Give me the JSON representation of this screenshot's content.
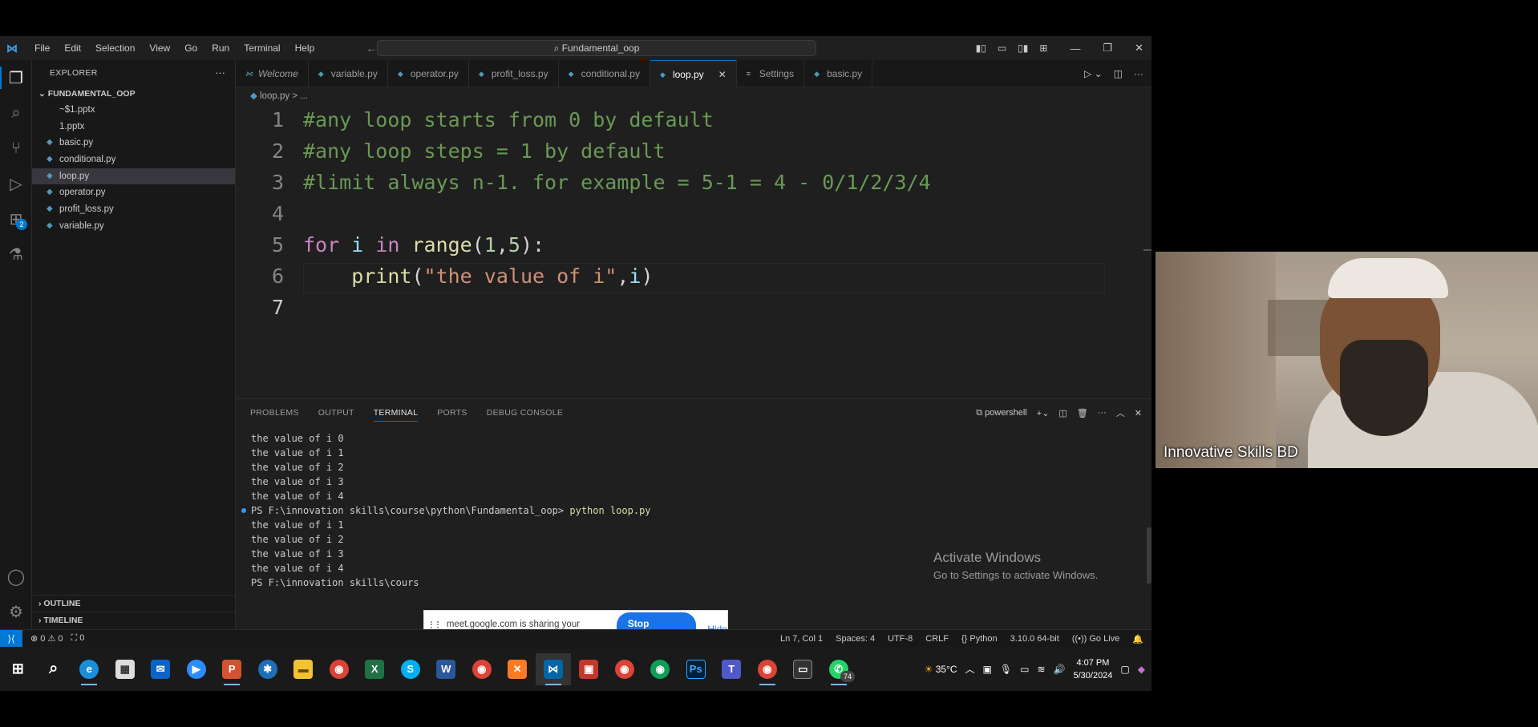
{
  "menu": [
    "File",
    "Edit",
    "Selection",
    "View",
    "Go",
    "Run",
    "Terminal",
    "Help"
  ],
  "command_center": "Fundamental_oop",
  "sidebar": {
    "title": "EXPLORER",
    "folder": "FUNDAMENTAL_OOP",
    "files": [
      "~$1.pptx",
      "1.pptx",
      "basic.py",
      "conditional.py",
      "loop.py",
      "operator.py",
      "profit_loss.py",
      "variable.py"
    ],
    "active_file": "loop.py",
    "outline": "OUTLINE",
    "timeline": "TIMELINE"
  },
  "activity_badge": "2",
  "tabs": [
    {
      "label": "Welcome"
    },
    {
      "label": "variable.py"
    },
    {
      "label": "operator.py"
    },
    {
      "label": "profit_loss.py"
    },
    {
      "label": "conditional.py"
    },
    {
      "label": "loop.py"
    },
    {
      "label": "Settings"
    },
    {
      "label": "basic.py"
    }
  ],
  "breadcrumb": {
    "file": "loop.py",
    "rest": "> ..."
  },
  "code": {
    "line_numbers": [
      "1",
      "2",
      "3",
      "4",
      "5",
      "6",
      "7"
    ],
    "l1": "#any loop starts from 0 by default",
    "l2": "#any loop steps = 1 by default",
    "l3": "#limit always n-1. for example = 5-1 = 4 - 0/1/2/3/4",
    "l5_for": "for",
    "l5_i": " i ",
    "l5_in": "in",
    "l5_range": " range",
    "l5_open": "(",
    "l5_a": "1",
    "l5_comma": ",",
    "l5_b": "5",
    "l5_close": "):",
    "l6_print": "    print",
    "l6_open": "(",
    "l6_str": "\"the value of i\"",
    "l6_comma": ",",
    "l6_i": "i",
    "l6_close": ")"
  },
  "panel": {
    "tabs": [
      "PROBLEMS",
      "OUTPUT",
      "TERMINAL",
      "PORTS",
      "DEBUG CONSOLE"
    ],
    "shell": "powershell"
  },
  "terminal": {
    "first_run": [
      "the value of i 0",
      "the value of i 1",
      "the value of i 2",
      "the value of i 3",
      "the value of i 4"
    ],
    "prompt": "PS F:\\innovation skills\\course\\python\\Fundamental_oop>",
    "command": "python loop.py",
    "second_run": [
      "the value of i 1",
      "the value of i 2",
      "the value of i 3",
      "the value of i 4"
    ],
    "last_prompt": "PS F:\\innovation skills\\cours"
  },
  "activate_windows": {
    "title": "Activate Windows",
    "subtitle": "Go to Settings to activate Windows."
  },
  "share_bar": {
    "text": "meet.google.com is sharing your screen.",
    "stop": "Stop sharing",
    "hide": "Hide"
  },
  "status": {
    "errors": "0",
    "warnings": "0",
    "ports": "0",
    "position": "Ln 7, Col 1",
    "spaces": "Spaces: 4",
    "encoding": "UTF-8",
    "eol": "CRLF",
    "language": "Python",
    "interpreter": "3.10.0 64-bit",
    "golive": "Go Live"
  },
  "taskbar": {
    "weather": "35°C",
    "time": "4:07 PM",
    "date": "5/30/2024",
    "whatsapp_badge": "74"
  },
  "webcam": {
    "label": "Innovative Skills BD"
  }
}
